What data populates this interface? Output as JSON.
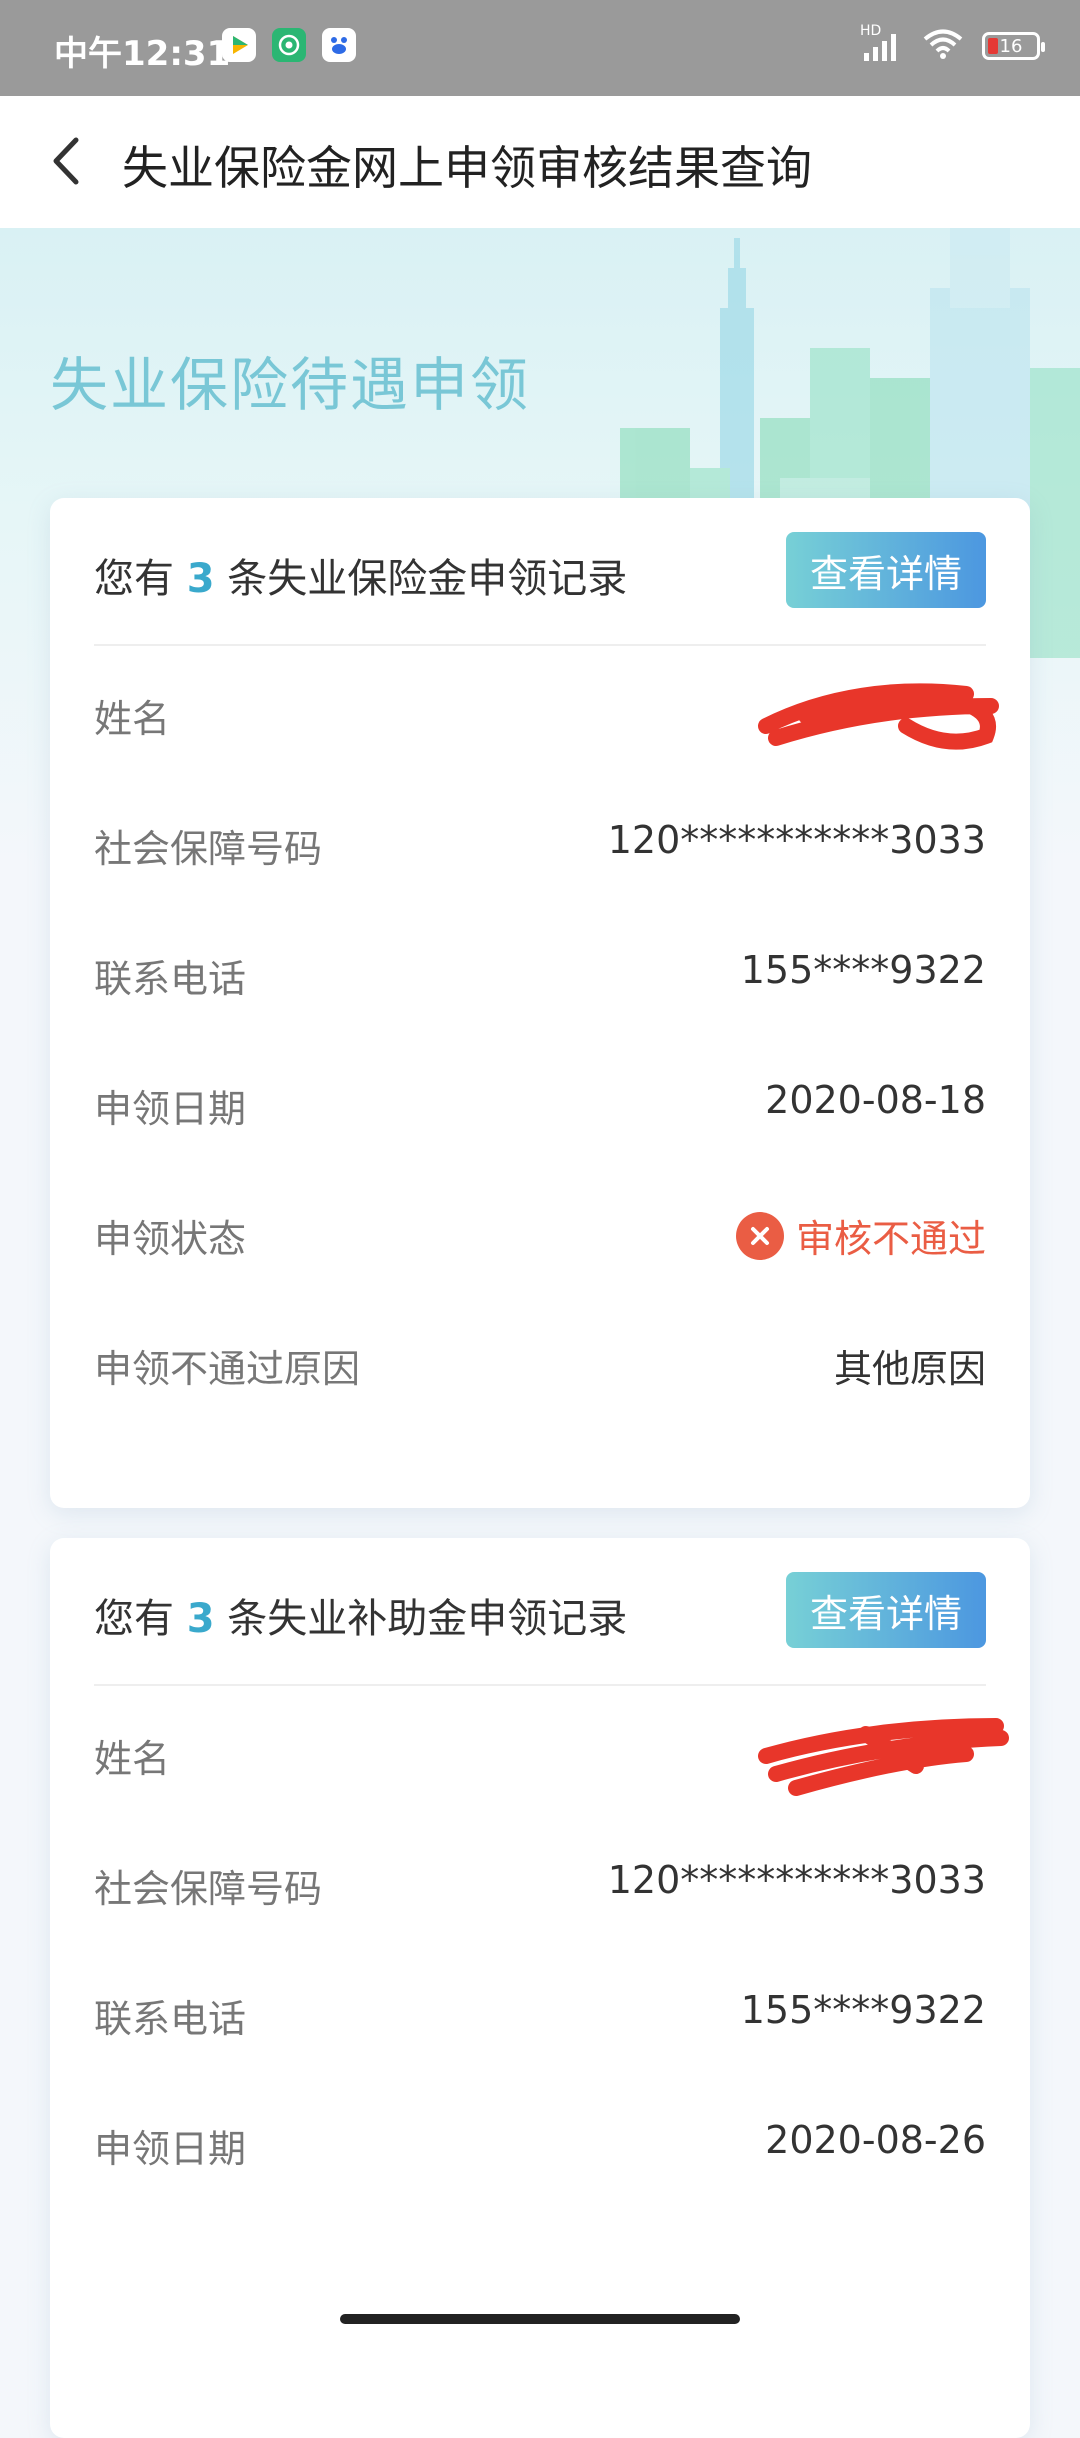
{
  "status_bar": {
    "time": "中午12:31",
    "network": "HD",
    "battery": "16"
  },
  "nav": {
    "title": "失业保险金网上申领审核结果查询"
  },
  "hero": {
    "title": "失业保险待遇申领"
  },
  "cards": [
    {
      "summary_prefix": "您有",
      "count": "3",
      "summary_suffix": "条失业保险金申领记录",
      "details_label": "查看详情",
      "rows": [
        {
          "label": "姓名",
          "value": ""
        },
        {
          "label": "社会保障号码",
          "value": "120***********3033"
        },
        {
          "label": "联系电话",
          "value": "155****9322"
        },
        {
          "label": "申领日期",
          "value": "2020-08-18"
        },
        {
          "label": "申领状态",
          "value": "审核不通过"
        },
        {
          "label": "申领不通过原因",
          "value": "其他原因"
        }
      ]
    },
    {
      "summary_prefix": "您有",
      "count": "3",
      "summary_suffix": "条失业补助金申领记录",
      "details_label": "查看详情",
      "rows": [
        {
          "label": "姓名",
          "value": ""
        },
        {
          "label": "社会保障号码",
          "value": "120***********3033"
        },
        {
          "label": "联系电话",
          "value": "155****9322"
        },
        {
          "label": "申领日期",
          "value": "2020-08-26"
        }
      ]
    }
  ],
  "colors": {
    "accent": "#3aa9cc",
    "fail": "#ea5d44",
    "redaction": "#e8362a"
  }
}
